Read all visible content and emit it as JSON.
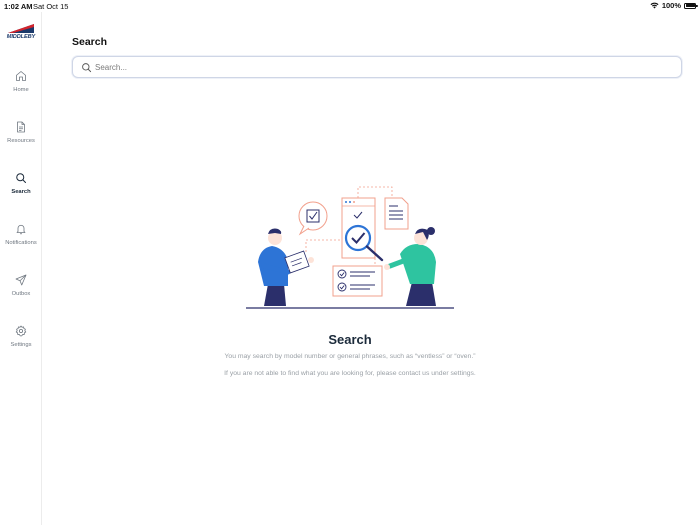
{
  "status_bar": {
    "time": "1:02 AM",
    "date": "Sat Oct 15",
    "battery": "100%"
  },
  "brand": {
    "logo_text": "MIDDLEBY"
  },
  "sidebar": {
    "items": [
      {
        "label": "Home",
        "icon": "home-icon",
        "active": false
      },
      {
        "label": "Resources",
        "icon": "document-icon",
        "active": false
      },
      {
        "label": "Search",
        "icon": "search-icon",
        "active": true
      },
      {
        "label": "Notifications",
        "icon": "bell-icon",
        "active": false
      },
      {
        "label": "Outbox",
        "icon": "paper-plane-icon",
        "active": false
      },
      {
        "label": "Settings",
        "icon": "gear-icon",
        "active": false
      }
    ]
  },
  "main": {
    "title": "Search",
    "search": {
      "placeholder": "Search...",
      "value": ""
    },
    "empty_state": {
      "title": "Search",
      "line1": "You may search by model number or general phrases, such as “ventless” or “oven.”",
      "line2": "If you are not able to find what you are looking for, please contact us under settings."
    }
  },
  "colors": {
    "accent": "#1b2a3a",
    "illustration_salmon": "#f2a08c",
    "illustration_blue": "#2d74d6",
    "illustration_teal": "#2ec4a0",
    "illustration_navy": "#2b2f6b"
  }
}
